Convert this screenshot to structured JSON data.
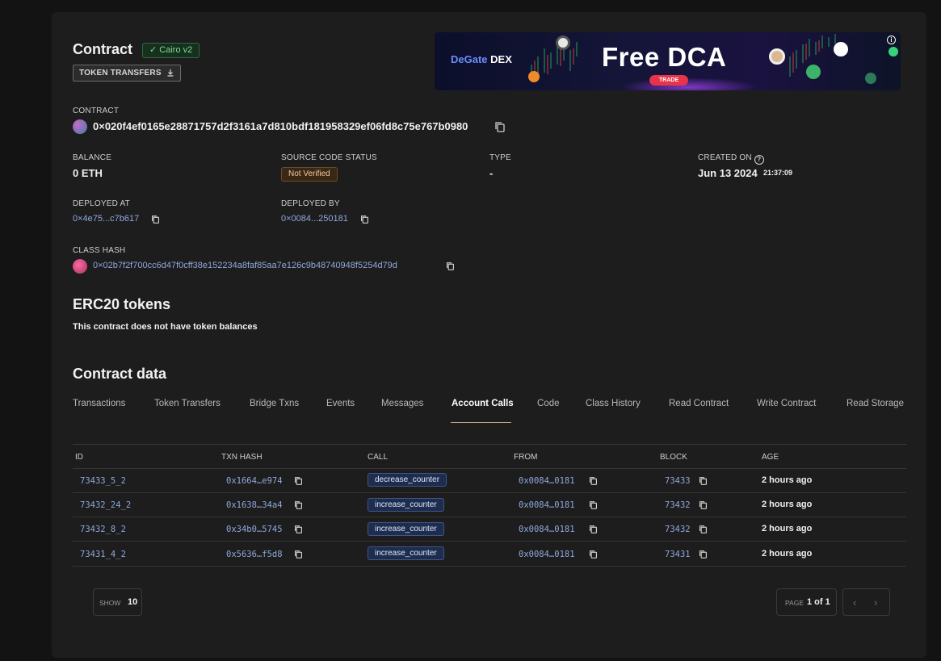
{
  "header": {
    "title": "Contract",
    "badge": "✓ Cairo v2",
    "token_transfers_button": "TOKEN TRANSFERS"
  },
  "banner": {
    "brand_prefix": "DeGate",
    "brand_suffix": " DEX",
    "headline": "Free DCA",
    "cta": "TRADE",
    "info": "i"
  },
  "contract": {
    "label": "CONTRACT",
    "address": "0×020f4ef0165e28871757d2f3161a7d810bdf181958329ef06fd8c75e767b0980"
  },
  "details": {
    "balance_label": "BALANCE",
    "balance_value": "0 ETH",
    "source_status_label": "SOURCE CODE STATUS",
    "source_status_value": "Not Verified",
    "type_label": "TYPE",
    "type_value": "-",
    "created_on_label": "CREATED ON",
    "created_on_date": "Jun 13 2024",
    "created_on_time": "21:37:09",
    "deployed_at_label": "DEPLOYED AT",
    "deployed_at_value": "0×4e75...c7b617",
    "deployed_by_label": "DEPLOYED BY",
    "deployed_by_value": "0×0084...250181",
    "class_hash_label": "CLASS HASH",
    "class_hash_value": "0×02b7f2f700cc6d47f0cff38e152234a8faf85aa7e126c9b48740948f5254d79d"
  },
  "erc20": {
    "title": "ERC20 tokens",
    "empty_note": "This contract does not have token balances"
  },
  "contract_data": {
    "title": "Contract data",
    "tabs": [
      "Transactions",
      "Token Transfers",
      "Bridge Txns",
      "Events",
      "Messages",
      "Account Calls",
      "Code",
      "Class History",
      "Read Contract",
      "Write Contract",
      "Read Storage"
    ],
    "active_tab": "Account Calls"
  },
  "table": {
    "headers": [
      "ID",
      "TXN HASH",
      "CALL",
      "FROM",
      "BLOCK",
      "AGE"
    ],
    "rows": [
      {
        "id": "73433_5_2",
        "txn_hash": "0x1664…e974",
        "call": "decrease_counter",
        "from": "0x0084…0181",
        "block": "73433",
        "age": "2 hours ago"
      },
      {
        "id": "73432_24_2",
        "txn_hash": "0x1638…34a4",
        "call": "increase_counter",
        "from": "0x0084…0181",
        "block": "73432",
        "age": "2 hours ago"
      },
      {
        "id": "73432_8_2",
        "txn_hash": "0x34b0…5745",
        "call": "increase_counter",
        "from": "0x0084…0181",
        "block": "73432",
        "age": "2 hours ago"
      },
      {
        "id": "73431_4_2",
        "txn_hash": "0x5636…f5d8",
        "call": "increase_counter",
        "from": "0x0084…0181",
        "block": "73431",
        "age": "2 hours ago"
      }
    ]
  },
  "pagination": {
    "show_label": "SHOW",
    "show_value": "10",
    "page_label": "PAGE",
    "page_value": "1 of 1",
    "prev": "‹",
    "next": "›"
  }
}
